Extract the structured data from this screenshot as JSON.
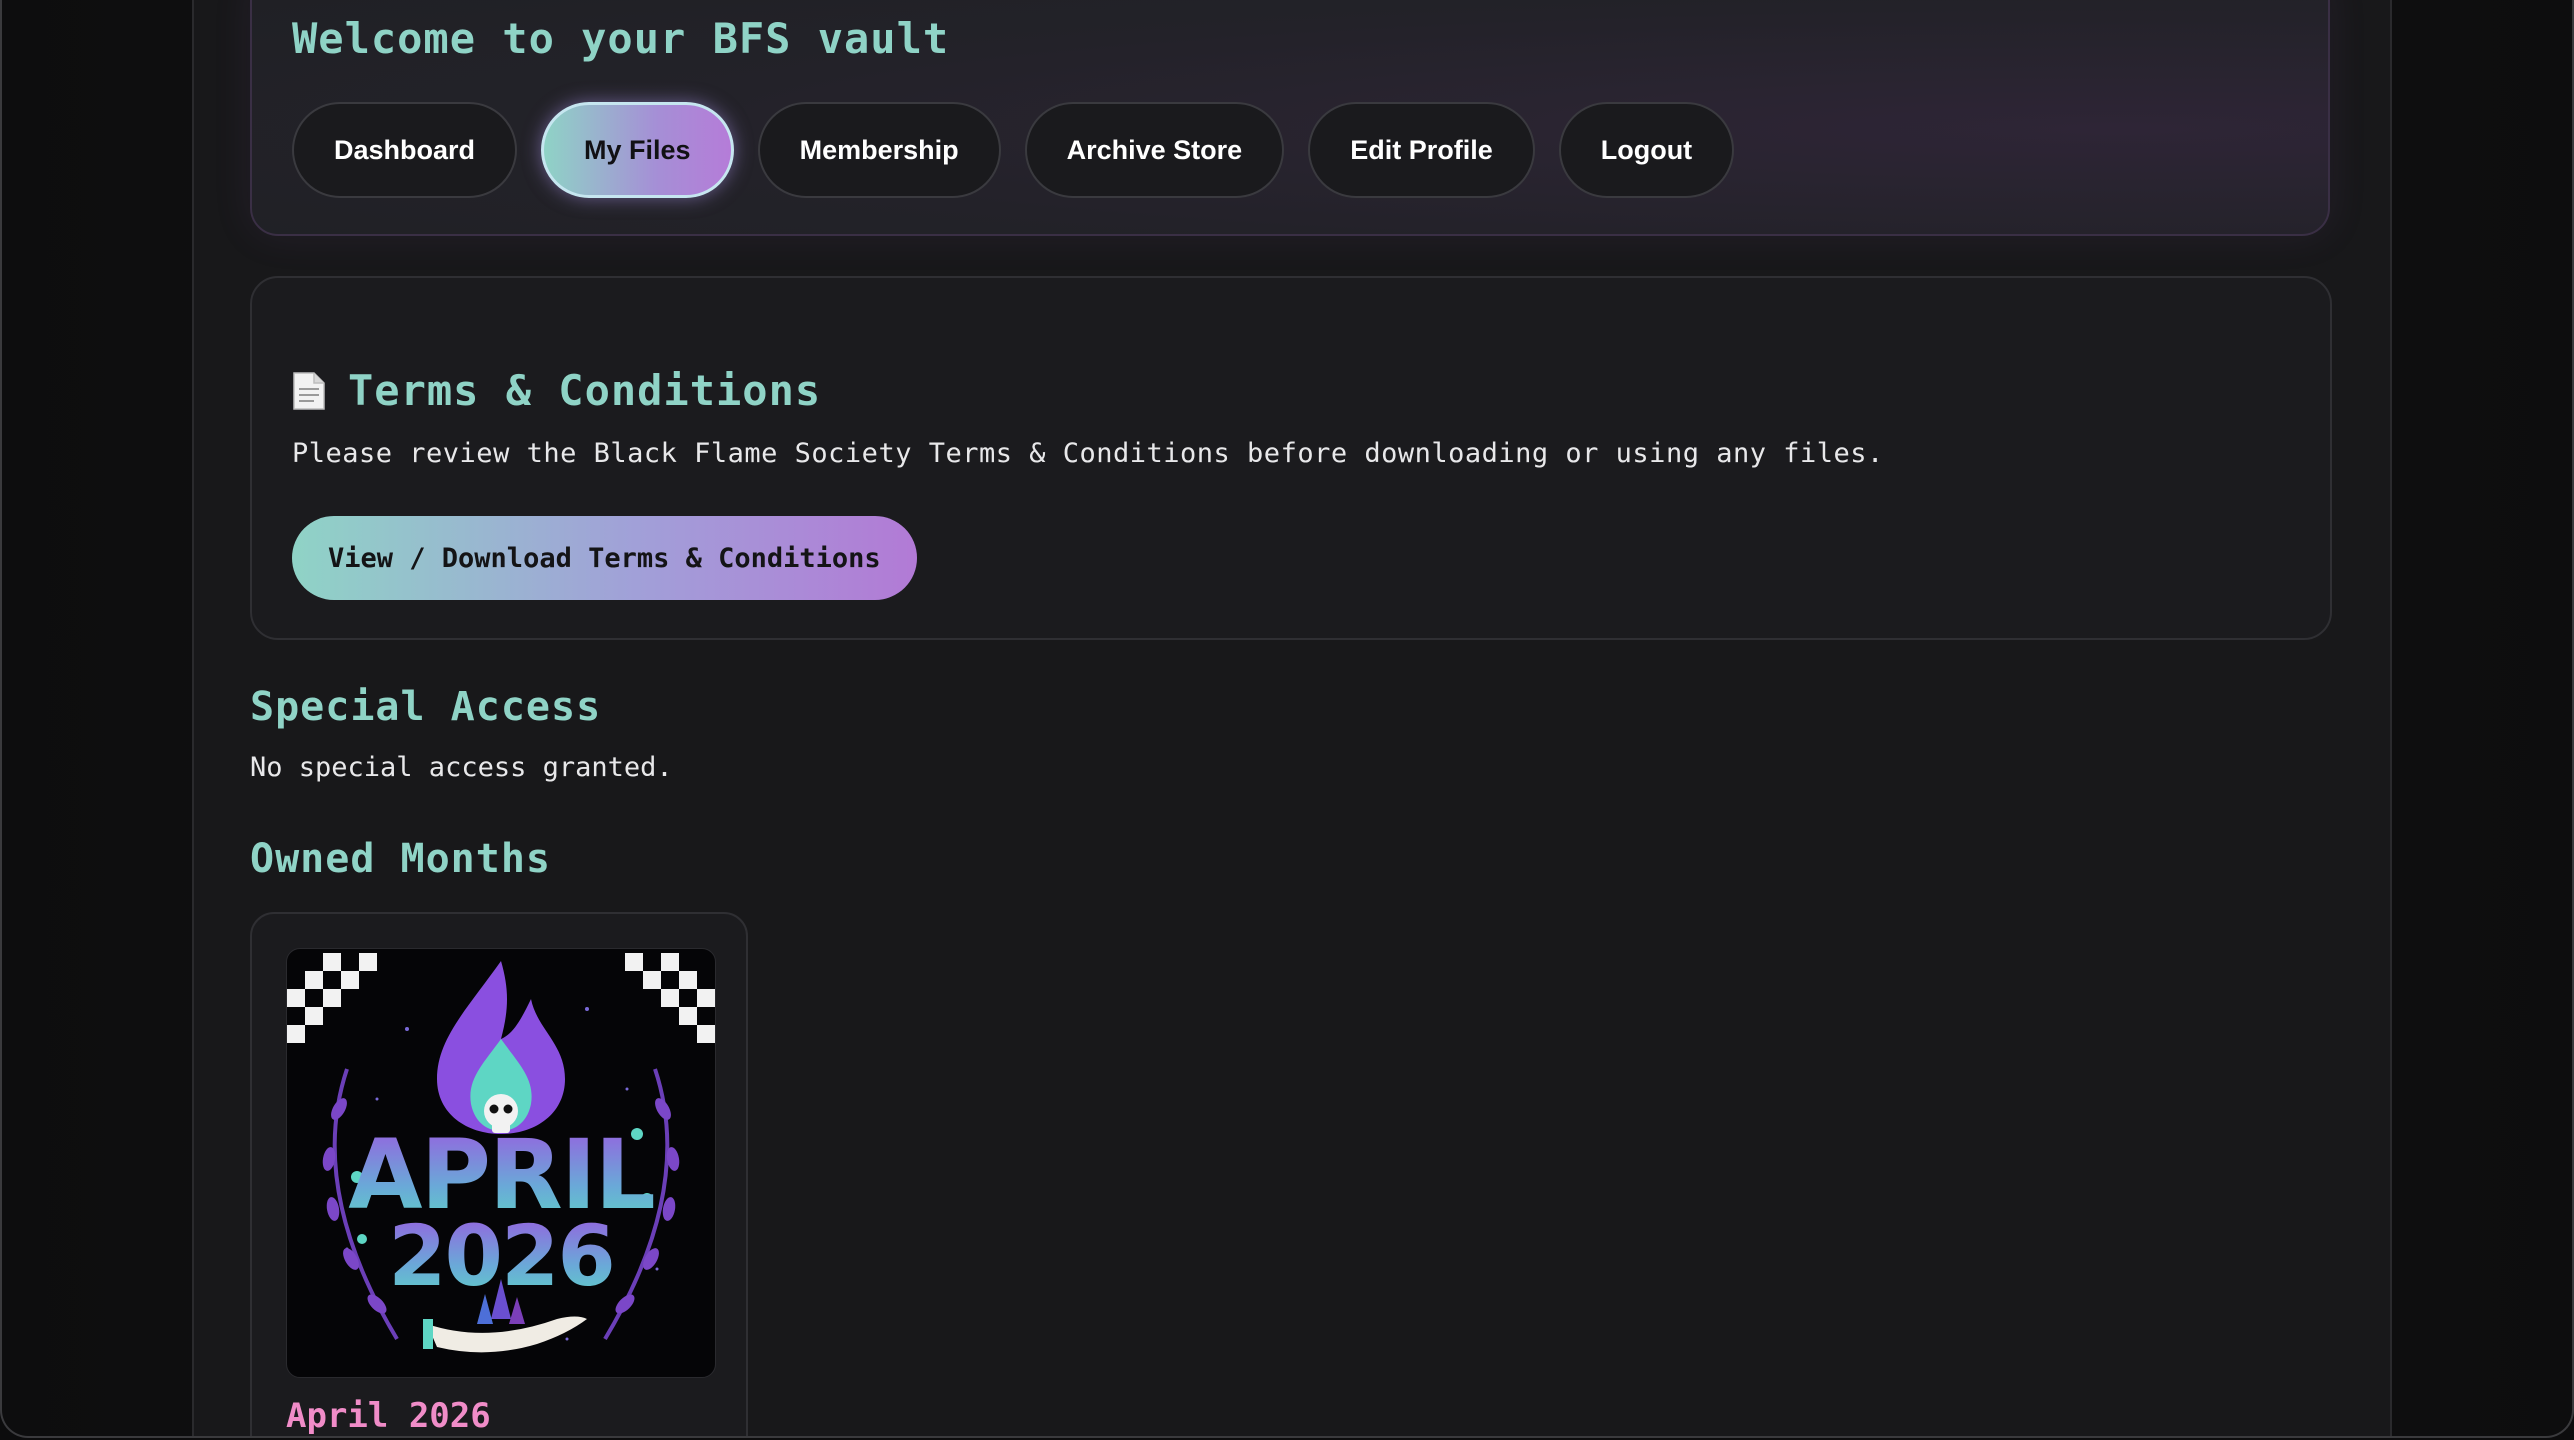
{
  "header": {
    "title": "Welcome to your BFS vault"
  },
  "nav": {
    "items": [
      {
        "label": "Dashboard",
        "active": false
      },
      {
        "label": "My Files",
        "active": true
      },
      {
        "label": "Membership",
        "active": false
      },
      {
        "label": "Archive Store",
        "active": false
      },
      {
        "label": "Edit Profile",
        "active": false
      },
      {
        "label": "Logout",
        "active": false
      }
    ]
  },
  "terms": {
    "icon": "document-icon",
    "title": "Terms & Conditions",
    "description": "Please review the Black Flame Society Terms & Conditions before downloading or using any files.",
    "button_label": "View / Download Terms & Conditions"
  },
  "special_access": {
    "title": "Special Access",
    "text": "No special access granted."
  },
  "owned_months": {
    "title": "Owned Months",
    "items": [
      {
        "label": "April 2026",
        "art_month": "APRIL",
        "art_year": "2026"
      }
    ]
  },
  "colors": {
    "accent_teal": "#8fd3c6",
    "accent_purple": "#b27ad6",
    "month_label_pink": "#f08cc8",
    "background": "#18181a"
  }
}
